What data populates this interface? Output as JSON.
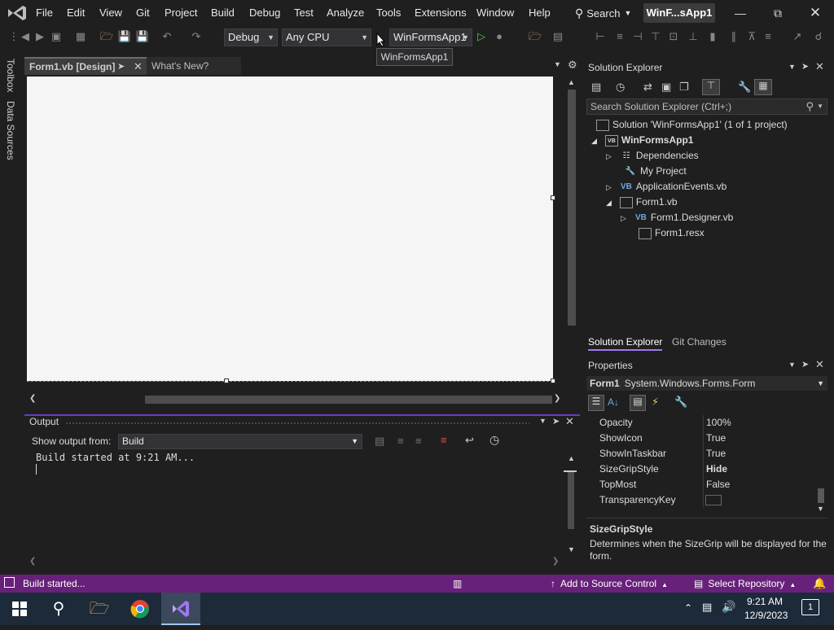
{
  "title_bar": {
    "menu": [
      "File",
      "Edit",
      "View",
      "Git",
      "Project",
      "Build",
      "Debug",
      "Test",
      "Analyze",
      "Tools",
      "Extensions",
      "Window",
      "Help"
    ],
    "search_label": "Search",
    "title": "WinF...sApp1"
  },
  "toolbar": {
    "configuration": "Debug",
    "platform": "Any CPU",
    "startup_project": "WinFormsApp1",
    "tooltip": "WinFormsApp1"
  },
  "left_rail": {
    "toolbox": "Toolbox",
    "data_sources": "Data Sources"
  },
  "document_tabs": [
    {
      "label": "Form1.vb [Design]",
      "active": true
    },
    {
      "label": "What's New?",
      "active": false
    }
  ],
  "output": {
    "title": "Output",
    "show_from_label": "Show output from:",
    "source": "Build",
    "text": "Build started at 9:21 AM..."
  },
  "solution_explorer": {
    "title": "Solution Explorer",
    "search_placeholder": "Search Solution Explorer (Ctrl+;)",
    "tree": [
      {
        "label": "Solution 'WinFormsApp1' (1 of 1 project)",
        "icon": "solution-icon"
      },
      {
        "label": "WinFormsApp1",
        "icon": "vb-project-icon"
      },
      {
        "label": "Dependencies",
        "icon": "dependencies-icon"
      },
      {
        "label": "My Project",
        "icon": "wrench-folder-icon"
      },
      {
        "label": "ApplicationEvents.vb",
        "icon": "vb-file-icon"
      },
      {
        "label": "Form1.vb",
        "icon": "form-icon"
      },
      {
        "label": "Form1.Designer.vb",
        "icon": "vb-file-icon"
      },
      {
        "label": "Form1.resx",
        "icon": "resx-icon"
      }
    ],
    "tabs": [
      "Solution Explorer",
      "Git Changes"
    ]
  },
  "properties": {
    "title": "Properties",
    "object_name": "Form1",
    "object_type": "System.Windows.Forms.Form",
    "rows": [
      {
        "name": "Opacity",
        "value": "100%"
      },
      {
        "name": "ShowIcon",
        "value": "True"
      },
      {
        "name": "ShowInTaskbar",
        "value": "True"
      },
      {
        "name": "SizeGripStyle",
        "value": "Hide"
      },
      {
        "name": "TopMost",
        "value": "False"
      },
      {
        "name": "TransparencyKey",
        "value": ""
      }
    ],
    "desc_title": "SizeGripStyle",
    "desc_text": "Determines when the SizeGrip will be displayed for the form."
  },
  "status_bar": {
    "message": "Build started...",
    "add_to_source_control": "Add to Source Control",
    "select_repository": "Select Repository"
  },
  "taskbar": {
    "time": "9:21 AM",
    "date": "12/9/2023",
    "notification_count": "1"
  },
  "colors": {
    "status_bar": "#68217a",
    "accent": "#6b3dbd"
  }
}
